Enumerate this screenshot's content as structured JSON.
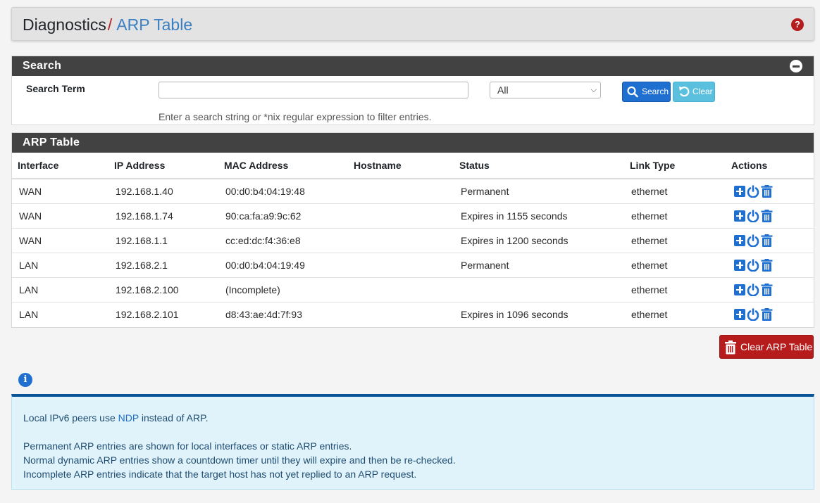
{
  "header": {
    "breadcrumb_first": "Diagnostics",
    "breadcrumb_sep": "/",
    "breadcrumb_current": "ARP Table",
    "help_icon": "?"
  },
  "search": {
    "title": "Search",
    "label": "Search Term",
    "input_value": "",
    "filter_selected": "All",
    "search_button": "Search",
    "clear_button": "Clear",
    "help_text": "Enter a search string or *nix regular expression to filter entries."
  },
  "arp": {
    "title": "ARP Table",
    "columns": [
      "Interface",
      "IP Address",
      "MAC Address",
      "Hostname",
      "Status",
      "Link Type",
      "Actions"
    ],
    "rows": [
      {
        "interface": "WAN",
        "ip": "192.168.1.40",
        "mac": "00:d0:b4:04:19:48",
        "hostname": "",
        "status": "Permanent",
        "link": "ethernet"
      },
      {
        "interface": "WAN",
        "ip": "192.168.1.74",
        "mac": "90:ca:fa:a9:9c:62",
        "hostname": "",
        "status": "Expires in 1155 seconds",
        "link": "ethernet"
      },
      {
        "interface": "WAN",
        "ip": "192.168.1.1",
        "mac": "cc:ed:dc:f4:36:e8",
        "hostname": "",
        "status": "Expires in 1200 seconds",
        "link": "ethernet"
      },
      {
        "interface": "LAN",
        "ip": "192.168.2.1",
        "mac": "00:d0:b4:04:19:49",
        "hostname": "",
        "status": "Permanent",
        "link": "ethernet"
      },
      {
        "interface": "LAN",
        "ip": "192.168.2.100",
        "mac": "(Incomplete)",
        "hostname": "",
        "status": "",
        "link": "ethernet"
      },
      {
        "interface": "LAN",
        "ip": "192.168.2.101",
        "mac": "d8:43:ae:4d:7f:93",
        "hostname": "",
        "status": "Expires in 1096 seconds",
        "link": "ethernet"
      }
    ],
    "clear_button": "Clear ARP Table"
  },
  "info": {
    "line1_pre": "Local IPv6 peers use ",
    "line1_link": "NDP",
    "line1_post": " instead of ARP.",
    "line2": "Permanent ARP entries are shown for local interfaces or static ARP entries.",
    "line3": "Normal dynamic ARP entries show a countdown timer until they will expire and then be re-checked.",
    "line4": "Incomplete ARP entries indicate that the target host has not yet replied to an ARP request."
  },
  "colors": {
    "accent": "#1e6fd0",
    "danger": "#b71c1c",
    "panel_heading": "#424242",
    "info_bg": "#e0f3fb"
  }
}
